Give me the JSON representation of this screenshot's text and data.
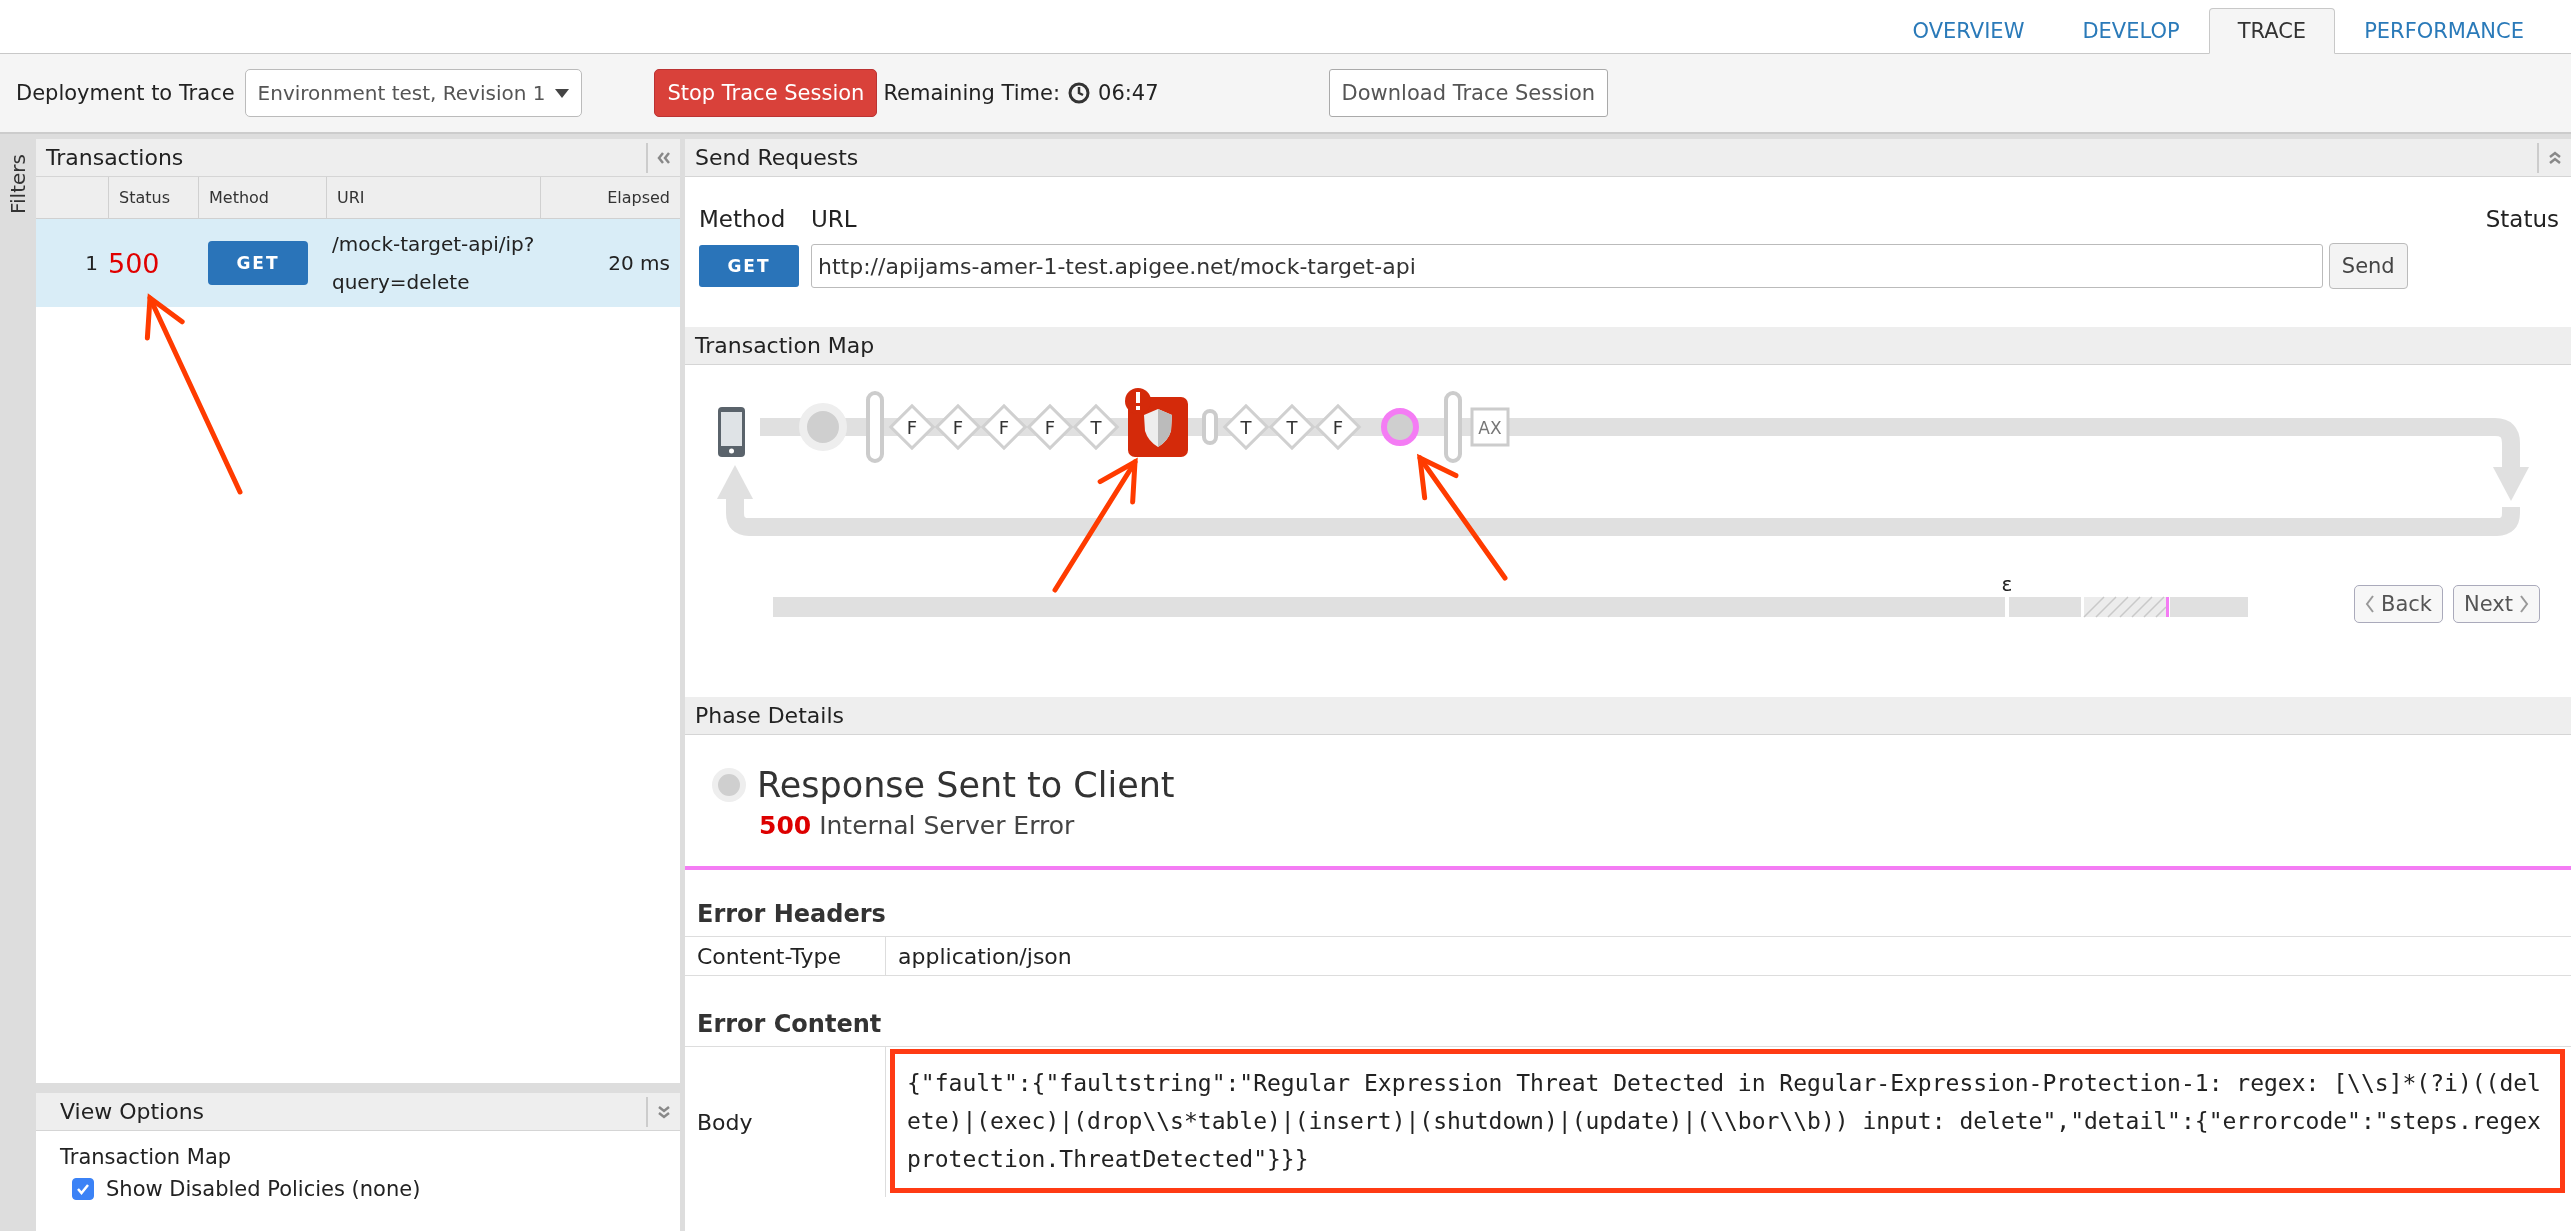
{
  "top_tabs": [
    {
      "label": "OVERVIEW",
      "selected": false
    },
    {
      "label": "DEVELOP",
      "selected": false
    },
    {
      "label": "TRACE",
      "selected": true
    },
    {
      "label": "PERFORMANCE",
      "selected": false
    }
  ],
  "toolbar": {
    "deployment_label": "Deployment to Trace",
    "deployment_value": "Environment test, Revision 1",
    "stop_button": "Stop Trace Session",
    "remaining_label": "Remaining Time:",
    "remaining_time": "06:47",
    "download_button": "Download Trace Session"
  },
  "sidebar_tab": "Filters",
  "transactions": {
    "title": "Transactions",
    "columns": [
      "Status",
      "Method",
      "URI",
      "Elapsed"
    ],
    "rows": [
      {
        "index": "1",
        "status": "500",
        "error": true,
        "method": "GET",
        "uri_lines": [
          "/mock-target-api/ip?",
          "query=delete"
        ],
        "elapsed": "20 ms",
        "selected": true
      }
    ]
  },
  "view_options": {
    "title": "View Options",
    "section": "Transaction Map",
    "options": [
      {
        "label": "Show Disabled Policies (none)",
        "checked": true
      }
    ]
  },
  "send_requests": {
    "title": "Send Requests",
    "method_label": "Method",
    "url_label": "URL",
    "status_label": "Status",
    "method": "GET",
    "url": "http://apijams-amer-1-test.apigee.net/mock-target-api",
    "send_button": "Send"
  },
  "transaction_map": {
    "title": "Transaction Map",
    "nodes": [
      {
        "kind": "start"
      },
      {
        "kind": "gate"
      },
      {
        "kind": "policy",
        "label": "F"
      },
      {
        "kind": "policy",
        "label": "F"
      },
      {
        "kind": "policy",
        "label": "F"
      },
      {
        "kind": "policy",
        "label": "F"
      },
      {
        "kind": "policy",
        "label": "T"
      },
      {
        "kind": "fault"
      },
      {
        "kind": "pin"
      },
      {
        "kind": "policy",
        "label": "T"
      },
      {
        "kind": "policy",
        "label": "T"
      },
      {
        "kind": "policy",
        "label": "F"
      },
      {
        "kind": "current"
      },
      {
        "kind": "gate"
      },
      {
        "kind": "target",
        "label": "AX"
      }
    ],
    "timeline_marker": "ε",
    "back_button": "Back",
    "next_button": "Next"
  },
  "phase_details": {
    "title": "Phase Details",
    "phase": "Response Sent to Client",
    "status_code": "500",
    "status_text": "Internal Server Error"
  },
  "error_headers": {
    "title": "Error Headers",
    "rows": [
      {
        "name": "Content-Type",
        "value": "application/json"
      }
    ]
  },
  "error_content": {
    "title": "Error Content",
    "rows": [
      {
        "name": "Body",
        "value": "{\"fault\":{\"faultstring\":\"Regular Expression Threat Detected in Regular-Expression-Protection-1: regex: [\\\\s]*(?i)((delete)|(exec)|(drop\\\\s*table)|(insert)|(shutdown)|(update)|(\\\\bor\\\\b)) input: delete\",\"detail\":{\"errorcode\":\"steps.regexprotection.ThreatDetected\"}}}"
      }
    ]
  }
}
